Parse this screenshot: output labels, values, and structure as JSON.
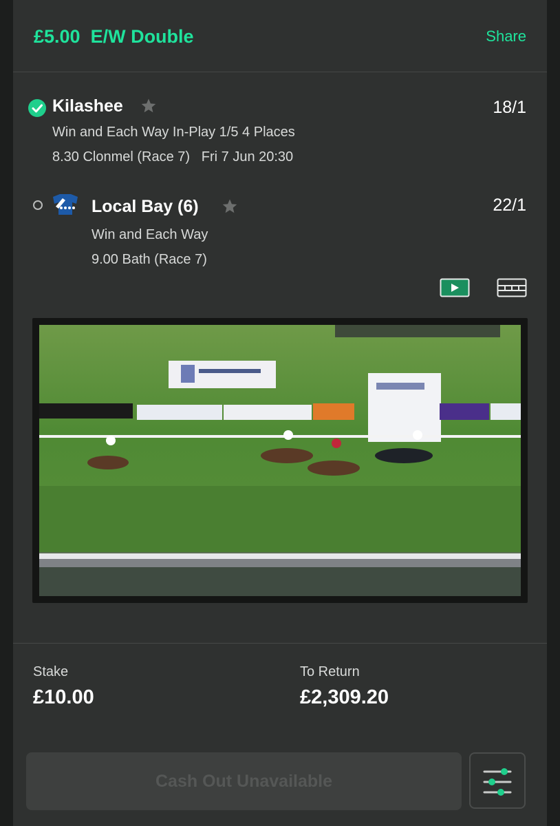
{
  "header": {
    "title": "£5.00  E/W Double",
    "share_label": "Share"
  },
  "selections": [
    {
      "status": "won",
      "name": "Kilashee",
      "odds": "18/1",
      "market": "Win and Each Way In-Play 1/5 4 Places",
      "event": "8.30 Clonmel (Race 7)   Fri 7 Jun 20:30"
    },
    {
      "status": "open",
      "name": "Local Bay (6)",
      "odds": "22/1",
      "market": "Win and Each Way",
      "event": "9.00 Bath (Race 7)"
    }
  ],
  "media": {
    "video_icon": "play-video-icon",
    "racecard_icon": "racecard-icon"
  },
  "bet_summary": {
    "stake_label": "Stake",
    "stake_value": "£10.00",
    "return_label": "To Return",
    "return_value": "£2,309.20"
  },
  "cashout": {
    "label": "Cash Out Unavailable",
    "settings_icon": "sliders-icon"
  },
  "colors": {
    "accent": "#1fe39c",
    "card_bg": "#2f3130",
    "page_bg": "#1c1e1d"
  }
}
